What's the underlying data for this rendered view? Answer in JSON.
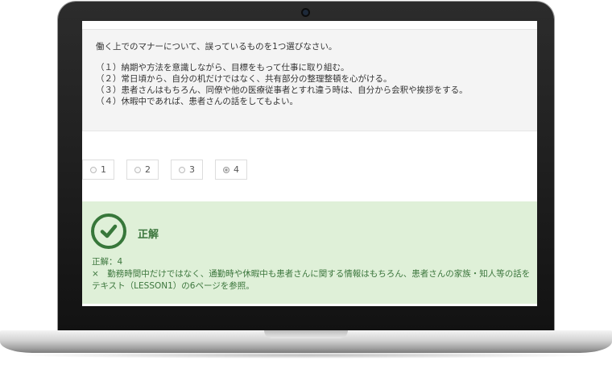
{
  "question": {
    "text": "働く上でのマナーについて、誤っているものを1つ選びなさい。",
    "options": [
      "（１）納期や方法を意識しながら、目標をもって仕事に取り組む。",
      "（２）常日頃から、自分の机だけではなく、共有部分の整理整頓を心がける。",
      "（３）患者さんはもちろん、同僚や他の医療従事者とすれ違う時は、自分から会釈や挨拶をする。",
      "（４）休暇中であれば、患者さんの話をしてもよい。"
    ]
  },
  "choices": [
    {
      "label": "1",
      "selected": false
    },
    {
      "label": "2",
      "selected": false
    },
    {
      "label": "3",
      "selected": false
    },
    {
      "label": "4",
      "selected": true
    }
  ],
  "result": {
    "title": "正解",
    "answer": "正解：4",
    "explanation_1": "×　勤務時間中だけではなく、通勤時や休暇中も患者さんに関する情報はもちろん、患者さんの家族・知人等の話を",
    "explanation_2": "テキスト（LESSON1）の6ページを参照。",
    "icon": "check-circle-icon",
    "color": "#3c763d",
    "background": "#dff0d8"
  }
}
